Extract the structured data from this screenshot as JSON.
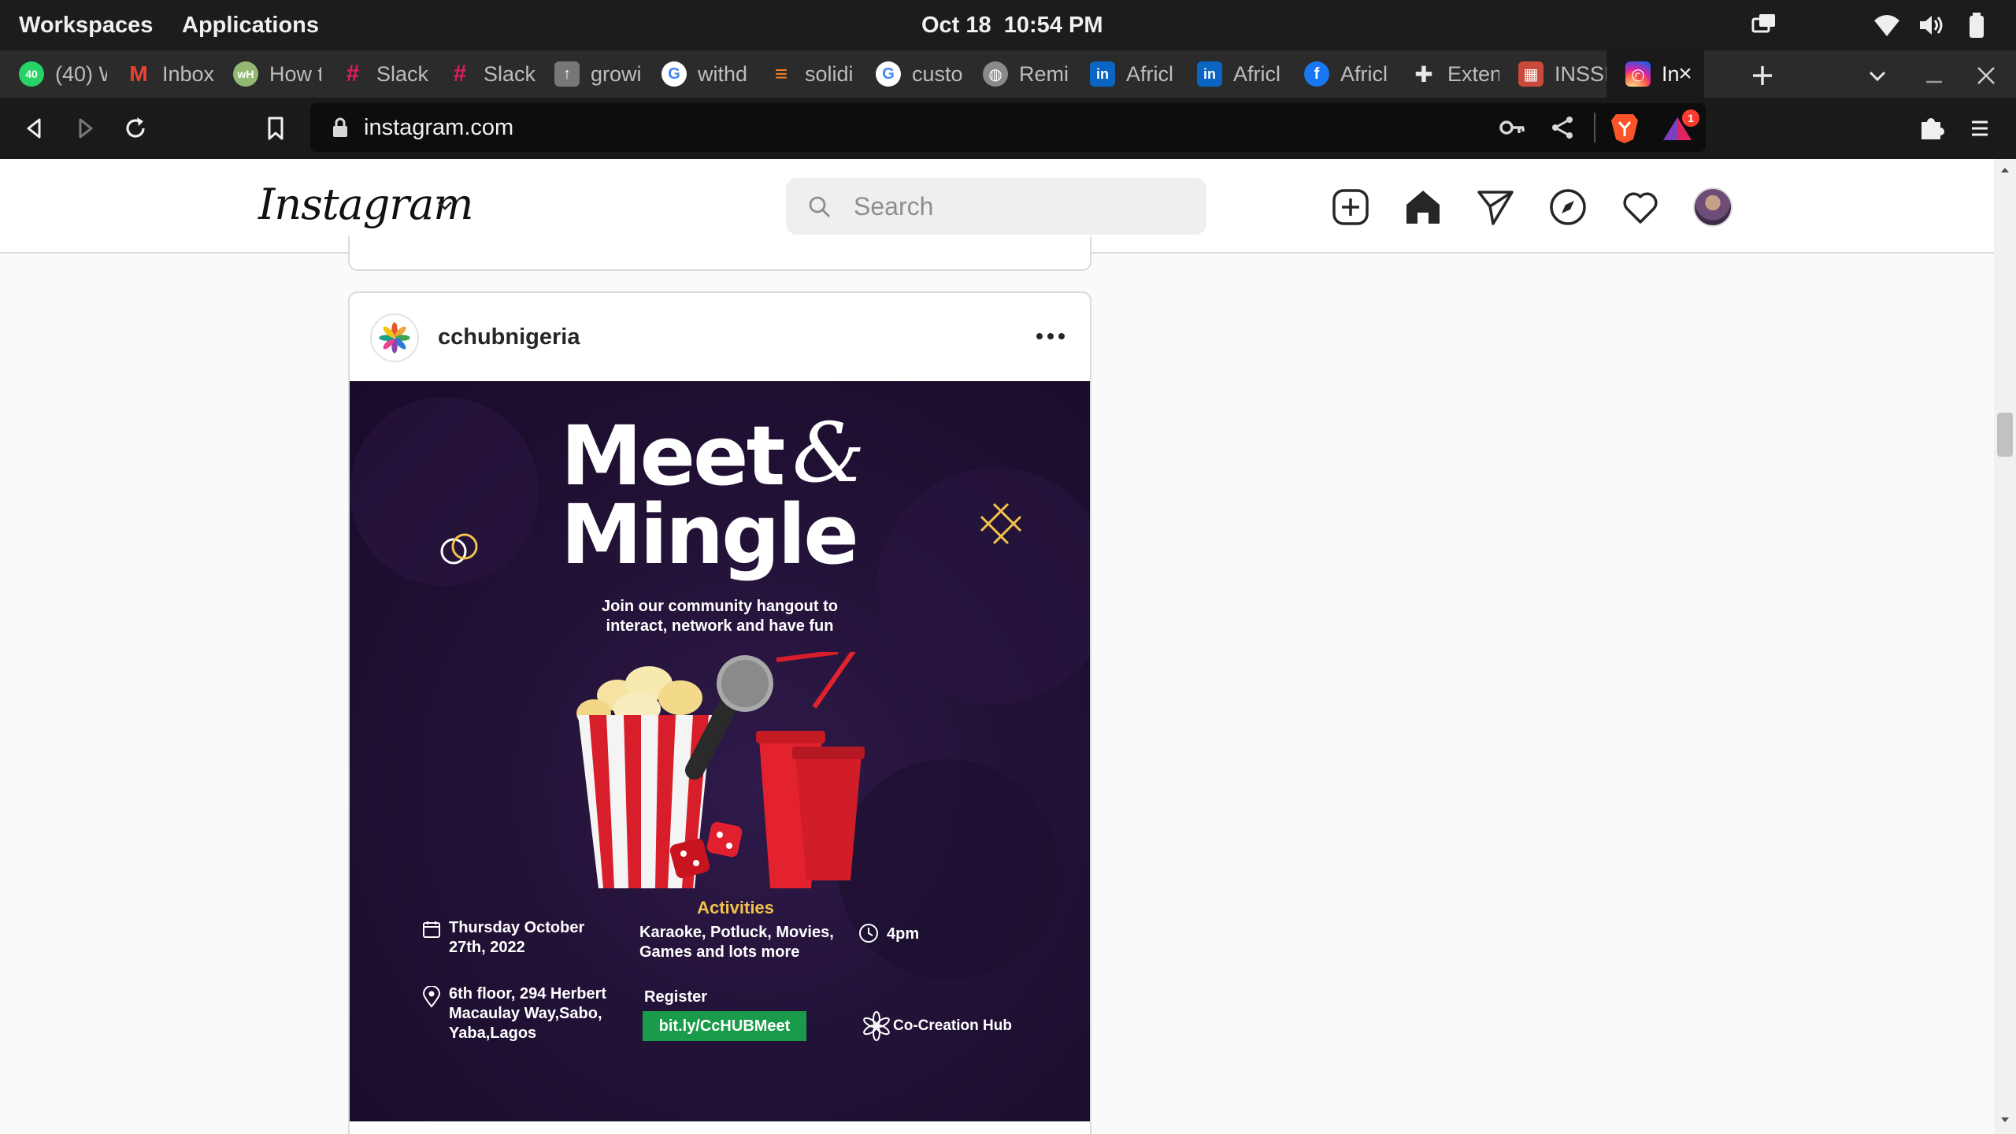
{
  "os_bar": {
    "workspaces": "Workspaces",
    "applications": "Applications",
    "clock": "Oct 18  10:54 PM",
    "tray_icons": [
      "screens-icon",
      "wifi-icon",
      "volume-icon",
      "battery-icon"
    ]
  },
  "tabs": [
    {
      "label": "(40) W",
      "icon": "whatsapp-icon",
      "color": "#25d366",
      "glyph": "40"
    },
    {
      "label": "Inbox",
      "icon": "gmail-icon",
      "color": "#ea4335",
      "glyph": "M"
    },
    {
      "label": "How t",
      "icon": "wikihow-icon",
      "color": "#93b874",
      "glyph": "wH"
    },
    {
      "label": "Slack",
      "icon": "slack-icon",
      "color": "#e01e5a",
      "glyph": "#"
    },
    {
      "label": "Slack",
      "icon": "slack-icon",
      "color": "#e01e5a",
      "glyph": "#"
    },
    {
      "label": "growi",
      "icon": "growth-icon",
      "color": "#777777",
      "glyph": "↑"
    },
    {
      "label": "withd",
      "icon": "google-icon",
      "color": "#4285f4",
      "glyph": "G"
    },
    {
      "label": "solidi",
      "icon": "stackoverflow-icon",
      "color": "#f48024",
      "glyph": "≡"
    },
    {
      "label": "custo",
      "icon": "google-icon",
      "color": "#4285f4",
      "glyph": "G"
    },
    {
      "label": "Remi",
      "icon": "globe-icon",
      "color": "#8a8a8a",
      "glyph": "◍"
    },
    {
      "label": "Africl",
      "icon": "linkedin-icon",
      "color": "#0a66c2",
      "glyph": "in"
    },
    {
      "label": "Africl",
      "icon": "linkedin-icon",
      "color": "#0a66c2",
      "glyph": "in"
    },
    {
      "label": "Africl",
      "icon": "facebook-icon",
      "color": "#1877f2",
      "glyph": "f"
    },
    {
      "label": "Exten",
      "icon": "extension-icon",
      "color": "#5a5a5a",
      "glyph": "✚"
    },
    {
      "label": "INSSI",
      "icon": "inssi-icon",
      "color": "#c94a3a",
      "glyph": "▦"
    }
  ],
  "active_tab": {
    "label": "In",
    "icon": "instagram-icon",
    "color": "#e1306c"
  },
  "toolbar": {
    "url": "instagram.com"
  },
  "shields_badge": "1",
  "instagram": {
    "logo": "Instagram",
    "search_placeholder": "Search"
  },
  "post": {
    "username": "cchubnigeria",
    "flyer": {
      "title_line1": "Meet",
      "ampersand": "&",
      "title_line2": "Mingle",
      "tagline": "Join our community hangout to interact, network and have fun",
      "date": "Thursday October 27th, 2022",
      "activities_title": "Activities",
      "activities_text": "Karaoke, Potluck, Movies, Games and lots more",
      "time": "4pm",
      "address": "6th floor, 294 Herbert Macaulay Way,Sabo, Yaba,Lagos",
      "register_label": "Register",
      "register_link": "bit.ly/CcHUBMeet",
      "brand": "Co-Creation Hub"
    }
  },
  "colors": {
    "os_bg": "#1c1c1c",
    "tab_bg": "#2b2b2b",
    "toolbar_bg": "#1a1a1a",
    "flyer_bg": "#221237",
    "accent_yellow": "#f2c34a",
    "register_green": "#1a9b4a",
    "notification_red": "#ed4956"
  }
}
